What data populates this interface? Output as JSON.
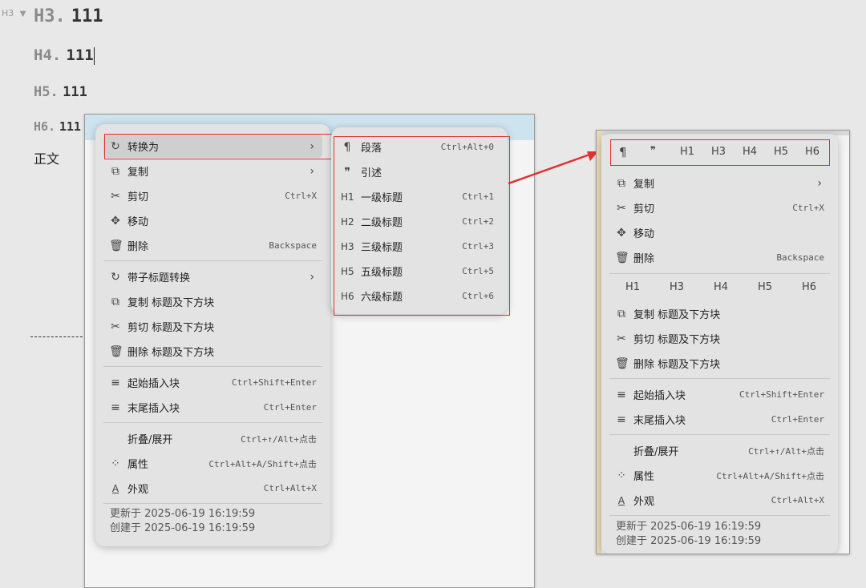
{
  "editor": {
    "gutter_label": "H3",
    "headings": [
      {
        "prefix": "H3.",
        "text": "111"
      },
      {
        "prefix": "H4.",
        "text": "111"
      },
      {
        "prefix": "H5.",
        "text": "111"
      },
      {
        "prefix": "H6.",
        "text": "111"
      }
    ],
    "body_text": "正文"
  },
  "left_menu": {
    "items": [
      {
        "icon": "convert-icon",
        "label": "转换为",
        "arrow": "›"
      },
      {
        "icon": "copy-icon",
        "label": "复制",
        "arrow": "›"
      },
      {
        "icon": "scissors-icon",
        "label": "剪切",
        "shortcut": "Ctrl+X"
      },
      {
        "icon": "move-icon",
        "label": "移动"
      },
      {
        "icon": "trash-icon",
        "label": "删除",
        "shortcut": "Backspace"
      },
      {
        "icon": "convert-icon",
        "label": "带子标题转换",
        "arrow": "›"
      },
      {
        "icon": "copy-icon",
        "label": "复制 标题及下方块"
      },
      {
        "icon": "scissors-icon",
        "label": "剪切 标题及下方块"
      },
      {
        "icon": "trash-icon",
        "label": "删除 标题及下方块"
      },
      {
        "icon": "insert-before-icon",
        "label": "起始插入块",
        "shortcut": "Ctrl+Shift+Enter"
      },
      {
        "icon": "insert-after-icon",
        "label": "末尾插入块",
        "shortcut": "Ctrl+Enter"
      },
      {
        "icon": "",
        "label": "折叠/展开",
        "shortcut": "Ctrl+↑/Alt+点击"
      },
      {
        "icon": "attributes-icon",
        "label": "属性",
        "shortcut": "Ctrl+Alt+A/Shift+点击"
      },
      {
        "icon": "appearance-icon",
        "label": "外观",
        "shortcut": "Ctrl+Alt+X"
      }
    ],
    "updated": "更新于 2025-06-19 16:19:59",
    "created": "创建于 2025-06-19 16:19:59"
  },
  "submenu": {
    "items": [
      {
        "icon": "¶",
        "label": "段落",
        "shortcut": "Ctrl+Alt+0"
      },
      {
        "icon": "❞",
        "label": "引述",
        "shortcut": ""
      },
      {
        "icon": "H1",
        "label": "一级标题",
        "shortcut": "Ctrl+1"
      },
      {
        "icon": "H2",
        "label": "二级标题",
        "shortcut": "Ctrl+2"
      },
      {
        "icon": "H3",
        "label": "三级标题",
        "shortcut": "Ctrl+3"
      },
      {
        "icon": "H5",
        "label": "五级标题",
        "shortcut": "Ctrl+5"
      },
      {
        "icon": "H6",
        "label": "六级标题",
        "shortcut": "Ctrl+6"
      }
    ]
  },
  "right_menu": {
    "toolbar": [
      "¶",
      "❞",
      "H1",
      "H3",
      "H4",
      "H5",
      "H6"
    ],
    "items_top": [
      {
        "label": "复制",
        "arrow": "›"
      },
      {
        "label": "剪切",
        "shortcut": "Ctrl+X"
      },
      {
        "label": "移动"
      },
      {
        "label": "删除",
        "shortcut": "Backspace"
      }
    ],
    "heading_row": [
      "H1",
      "H3",
      "H4",
      "H5",
      "H6"
    ],
    "items_mid": [
      {
        "label": "复制 标题及下方块"
      },
      {
        "label": "剪切 标题及下方块"
      },
      {
        "label": "删除 标题及下方块"
      },
      {
        "label": "起始插入块",
        "shortcut": "Ctrl+Shift+Enter"
      },
      {
        "label": "末尾插入块",
        "shortcut": "Ctrl+Enter"
      },
      {
        "label": "折叠/展开",
        "shortcut": "Ctrl+↑/Alt+点击"
      },
      {
        "label": "属性",
        "shortcut": "Ctrl+Alt+A/Shift+点击"
      },
      {
        "label": "外观",
        "shortcut": "Ctrl+Alt+X"
      }
    ],
    "updated": "更新于 2025-06-19 16:19:59",
    "created": "创建于 2025-06-19 16:19:59"
  },
  "colors": {
    "highlight": "#e03030",
    "menu_bg": "#e3e3e3",
    "selected_bg": "#cfcfcf"
  }
}
